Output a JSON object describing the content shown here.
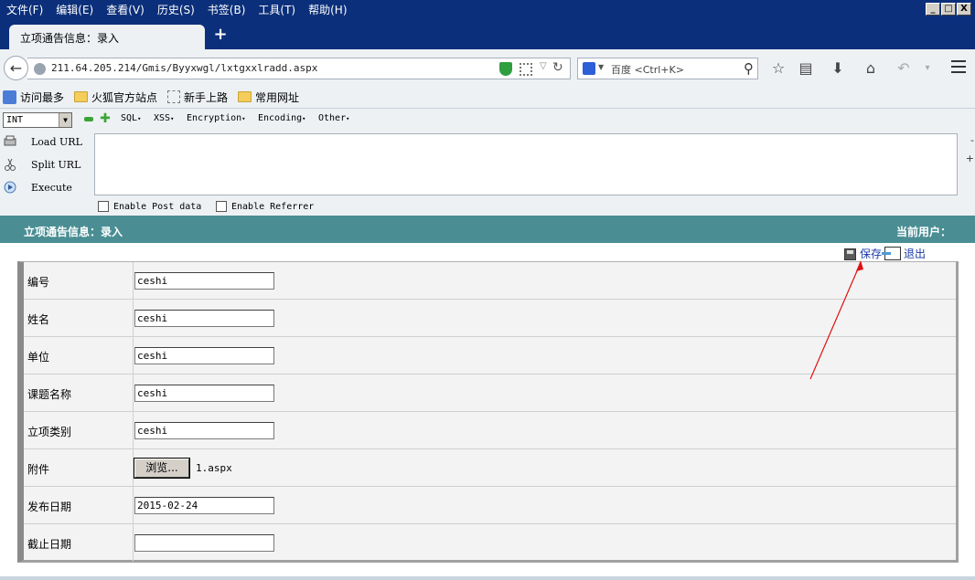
{
  "menubar": {
    "items": [
      "文件(F)",
      "编辑(E)",
      "查看(V)",
      "历史(S)",
      "书签(B)",
      "工具(T)",
      "帮助(H)"
    ],
    "window_buttons": [
      "_",
      "□",
      "X"
    ]
  },
  "tabs": [
    {
      "label": "立项通告信息：录入"
    }
  ],
  "new_tab_label": "+",
  "navbar": {
    "url": "211.64.205.214/Gmis/Byyxwgl/lxtgxxlradd.aspx",
    "search_placeholder": "百度 <Ctrl+K>"
  },
  "bookmarks": [
    "访问最多",
    "火狐官方站点",
    "新手上路",
    "常用网址"
  ],
  "hackbar": {
    "type_select": "INT",
    "menus": [
      "SQL",
      "XSS",
      "Encryption",
      "Encoding",
      "Other"
    ],
    "actions": [
      "Load URL",
      "Split URL",
      "Execute"
    ],
    "post_data_label": "Enable Post data",
    "referrer_label": "Enable Referrer",
    "side_minus": "-",
    "side_plus": "+"
  },
  "page": {
    "title": "立项通告信息：录入",
    "current_user_label": "当前用户：",
    "save_label": "保存",
    "exit_label": "退出",
    "form": [
      {
        "label": "编号",
        "type": "text",
        "value": "ceshi"
      },
      {
        "label": "姓名",
        "type": "text",
        "value": "ceshi"
      },
      {
        "label": "单位",
        "type": "text",
        "value": "ceshi"
      },
      {
        "label": "课题名称",
        "type": "text",
        "value": "ceshi"
      },
      {
        "label": "立项类别",
        "type": "text",
        "value": "ceshi"
      },
      {
        "label": "附件",
        "type": "file",
        "button_label": "浏览...",
        "file_name": "1.aspx"
      },
      {
        "label": "发布日期",
        "type": "text",
        "value": "2015-02-24"
      },
      {
        "label": "截止日期",
        "type": "text",
        "value": ""
      }
    ]
  },
  "colors": {
    "menubar_bg": "#0b2f7a",
    "page_header_bg": "#4a8e94",
    "link_color": "#1a3aa8",
    "annotation_arrow": "#e01010"
  }
}
